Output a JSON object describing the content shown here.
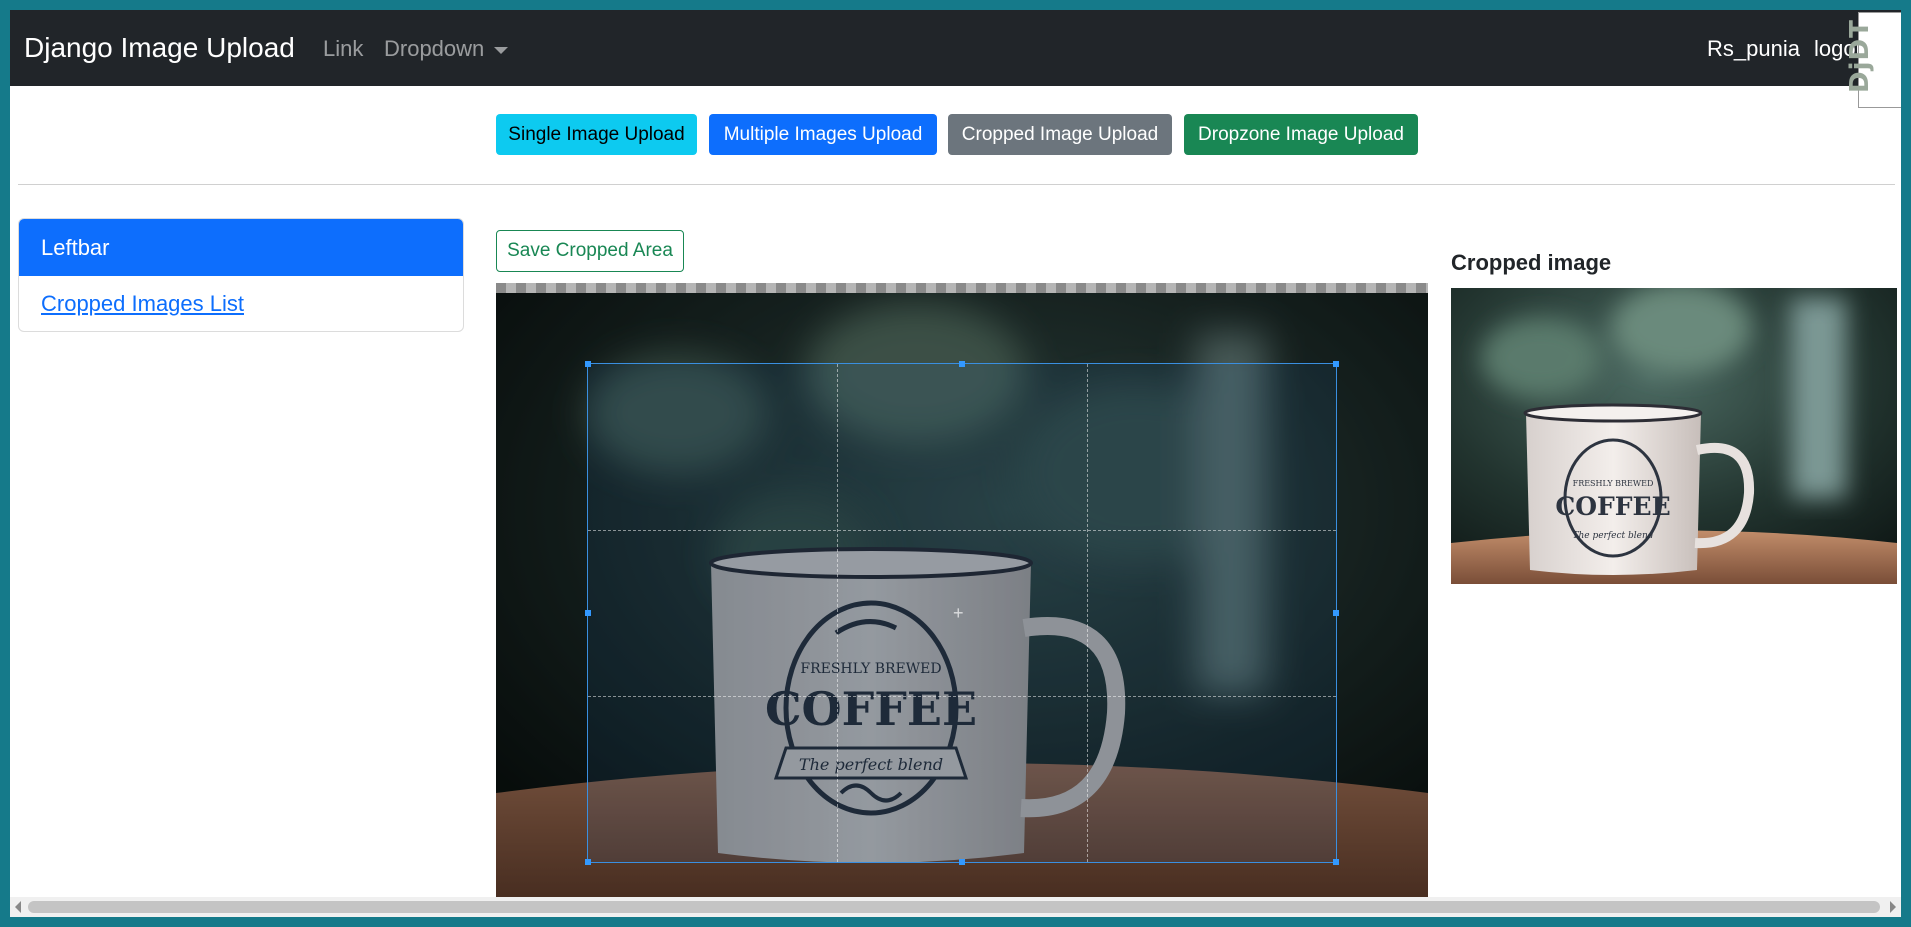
{
  "navbar": {
    "brand": "Django Image Upload",
    "link": "Link",
    "dropdown": "Dropdown",
    "user": "Rs_punia",
    "logout": "logout",
    "debug_toolbar": "DjDT"
  },
  "upload_buttons": {
    "single": "Single Image Upload",
    "multiple": "Multiple Images Upload",
    "cropped": "Cropped Image Upload",
    "dropzone": "Dropzone Image Upload"
  },
  "leftbar": {
    "title": "Leftbar",
    "items": [
      {
        "label": "Cropped Images List"
      }
    ]
  },
  "cropper": {
    "save_label": "Save Cropped Area",
    "image_text": {
      "line1": "FRESHLY BREWED",
      "line2": "COFFEE",
      "line3": "The perfect blend"
    }
  },
  "preview": {
    "title": "Cropped image"
  },
  "colors": {
    "navbar": "#212529",
    "info": "#0dcaf0",
    "primary": "#0d6efd",
    "secondary": "#6c757d",
    "success": "#198754",
    "crop_outline": "#3399ff"
  }
}
